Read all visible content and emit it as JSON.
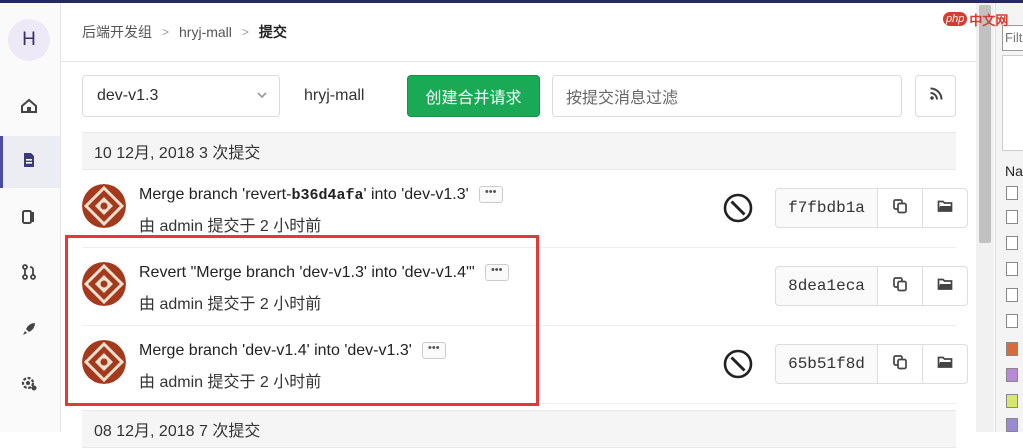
{
  "sidebar": {
    "avatar_letter": "H",
    "items": [
      {
        "icon": "home-icon"
      },
      {
        "icon": "document-icon"
      },
      {
        "icon": "issues-icon"
      },
      {
        "icon": "merge-request-icon"
      },
      {
        "icon": "rocket-icon"
      },
      {
        "icon": "settings-icon"
      }
    ]
  },
  "breadcrumb": {
    "items": [
      "后端开发组",
      "hryj-mall",
      "提交"
    ],
    "separator": ">"
  },
  "toolbar": {
    "branch_value": "dev-v1.3",
    "project_name": "hryj-mall",
    "create_merge_request_label": "创建合并请求",
    "filter_placeholder": "按提交消息过滤"
  },
  "day_groups": [
    {
      "header": "10 12月, 2018 3 次提交"
    },
    {
      "header": "08 12月, 2018 7 次提交"
    }
  ],
  "commits": [
    {
      "title_prefix": "Merge branch 'revert-",
      "title_code": "b36d4afa",
      "title_suffix": "' into 'dev-v1.3'",
      "meta": "由 admin 提交于 2 小时前",
      "ellipsis": "•••",
      "status": "canceled",
      "sha": "f7fbdb1a"
    },
    {
      "title": "Revert \"Merge branch 'dev-v1.3' into 'dev-v1.4'\"",
      "meta": "由 admin 提交于 2 小时前",
      "ellipsis": "•••",
      "status": "",
      "sha": "8dea1eca"
    },
    {
      "title": "Merge branch 'dev-v1.4' into 'dev-v1.3'",
      "meta": "由 admin 提交于 2 小时前",
      "ellipsis": "•••",
      "status": "canceled",
      "sha": "65b51f8d"
    }
  ],
  "right_panel": {
    "filter_text": "Filt",
    "column_label": "Na"
  },
  "watermark": {
    "logo": "php",
    "text": "中文网"
  },
  "colors": {
    "accent": "#1aaa55",
    "highlight": "#e53935",
    "nav_active": "#4b4ba3"
  }
}
